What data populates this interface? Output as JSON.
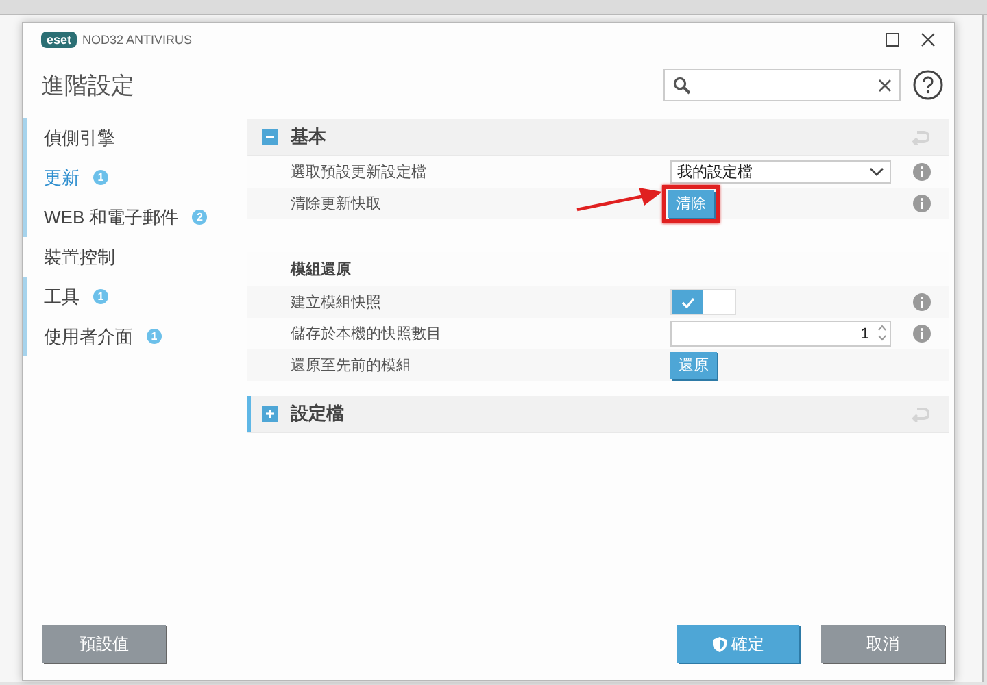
{
  "window": {
    "logo": "eset",
    "product": "NOD32 ANTIVIRUS",
    "title": "進階設定"
  },
  "sidebar": {
    "items": [
      {
        "label": "偵側引擎",
        "selected": false,
        "modified": true
      },
      {
        "label": "更新",
        "badge": "1",
        "selected": true,
        "modified": true
      },
      {
        "label": "WEB 和電子郵件",
        "badge": "2",
        "selected": false,
        "modified": true
      },
      {
        "label": "裝置控制",
        "selected": false,
        "modified": false
      },
      {
        "label": "工具",
        "badge": "1",
        "selected": false,
        "modified": true
      },
      {
        "label": "使用者介面",
        "badge": "1",
        "selected": false,
        "modified": true
      }
    ]
  },
  "sections": [
    {
      "title": "基本",
      "expanded": true,
      "focused": false,
      "rows": [
        {
          "kind": "select",
          "label": "選取預設更新設定檔",
          "value": "我的設定檔",
          "info": true
        },
        {
          "kind": "button",
          "label": "清除更新快取",
          "button": "清除",
          "highlighted": true,
          "info": true
        },
        {
          "kind": "heading",
          "label": "模組還原"
        },
        {
          "kind": "toggle",
          "label": "建立模組快照",
          "on": true,
          "info": true
        },
        {
          "kind": "number",
          "label": "儲存於本機的快照數目",
          "value": "1",
          "info": true
        },
        {
          "kind": "button",
          "label": "還原至先前的模組",
          "button": "還原",
          "highlighted": false,
          "info": false
        }
      ]
    },
    {
      "title": "設定檔",
      "expanded": false,
      "focused": true
    }
  ],
  "footer": {
    "default_button": "預設值",
    "ok_button": "確定",
    "cancel_button": "取消"
  }
}
